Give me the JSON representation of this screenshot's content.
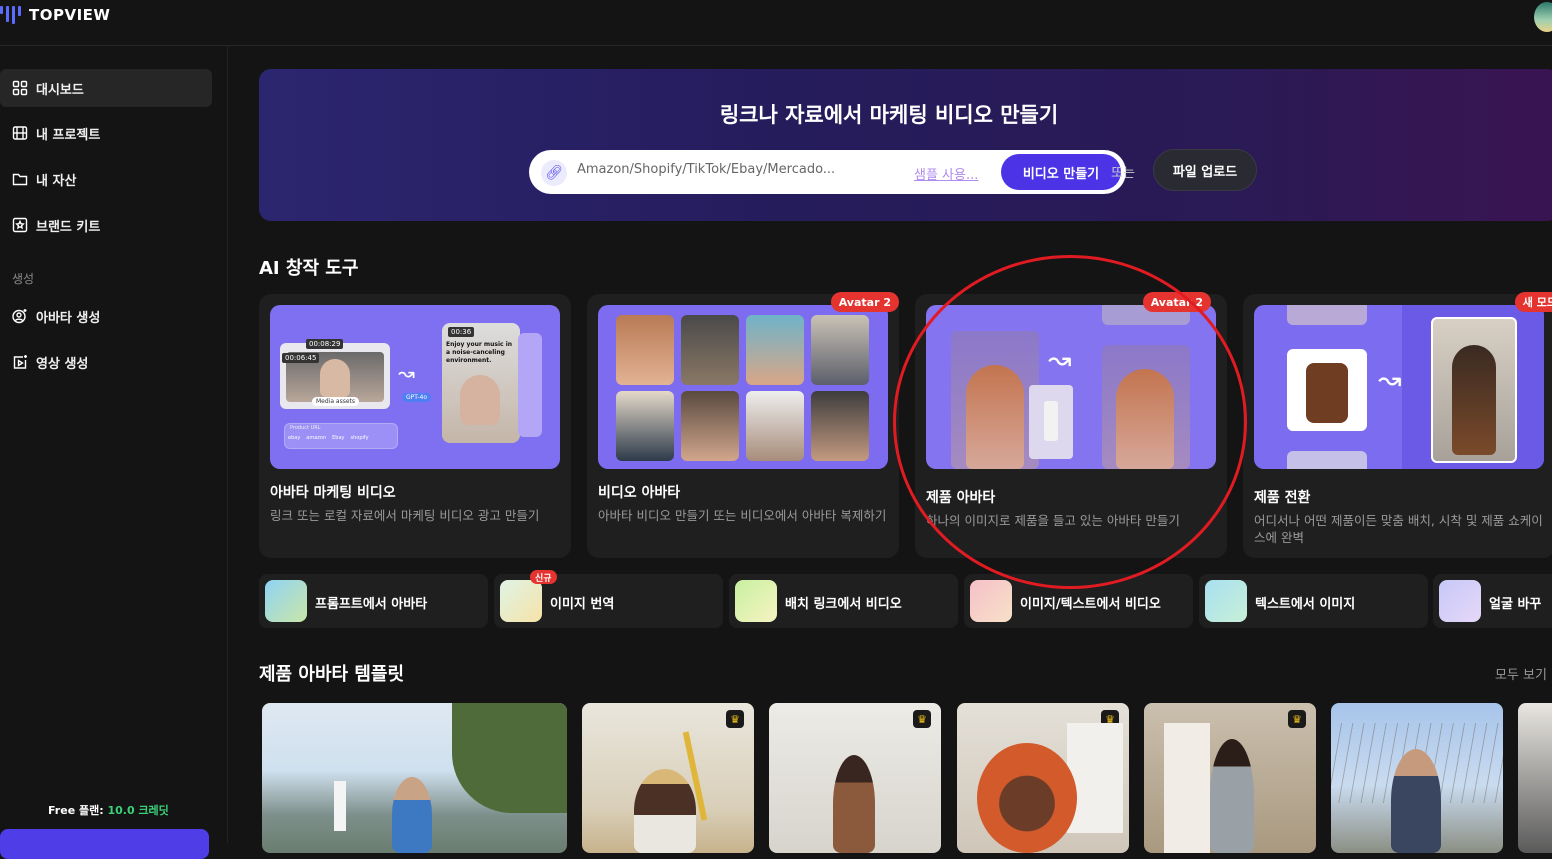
{
  "header": {
    "logo_text": "TOPVIEW"
  },
  "sidebar": {
    "items": [
      {
        "label": "대시보드",
        "icon": "grid-icon",
        "active": true
      },
      {
        "label": "내 프로젝트",
        "icon": "film-icon"
      },
      {
        "label": "내 자산",
        "icon": "folder-icon"
      },
      {
        "label": "브랜드 키트",
        "icon": "brand-star-icon"
      }
    ],
    "section_label": "생성",
    "create_items": [
      {
        "label": "아바타 생성",
        "icon": "avatar-sparkle-icon"
      },
      {
        "label": "영상 생성",
        "icon": "video-sparkle-icon"
      }
    ],
    "plan_prefix": "Free 플랜: ",
    "plan_credit": "10.0 크레딧"
  },
  "hero": {
    "title": "링크나 자료에서 마케팅 비디오 만들기",
    "input_placeholder": "Amazon/Shopify/TikTok/Ebay/Mercado...",
    "sample_link": "샘플 사용...",
    "make_button": "비디오 만들기",
    "or_text": "또는",
    "upload_button": "파일 업로드"
  },
  "ai_tools": {
    "title": "AI 창작 도구",
    "cards": [
      {
        "name": "아바타 마케팅 비디오",
        "desc": "링크 또는 로컬 자료에서 마케팅 비디오 광고 만들기",
        "badge": ""
      },
      {
        "name": "비디오 아바타",
        "desc": "아바타 비디오 만들기 또는 비디오에서 아바타 복제하기",
        "badge": "Avatar 2"
      },
      {
        "name": "제품 아바타",
        "desc": "하나의 이미지로 제품을 들고 있는 아바타 만들기",
        "badge": "Avatar 2"
      },
      {
        "name": "제품 전환",
        "desc": "어디서나 어떤 제품이든 맞춤 배치, 시착 및 제품 쇼케이스에 완벽",
        "badge": "새 모드"
      }
    ],
    "thumb_texts": {
      "time_a": "00:08:29",
      "time_b": "00:06:45",
      "time_c": "00:36",
      "caption": "Enjoy your music in a noise-canceling environment.",
      "media_chip": "Media assets",
      "gpt_chip": "GPT-4o",
      "product_url": "Product URL",
      "stores": [
        "ebay",
        "amazon",
        "Ebay",
        "shopify"
      ]
    }
  },
  "mini_tools": [
    {
      "label": "프롬프트에서 아바타",
      "new": ""
    },
    {
      "label": "이미지 번역",
      "new": "신규"
    },
    {
      "label": "배치 링크에서 비디오",
      "new": ""
    },
    {
      "label": "이미지/텍스트에서 비디오",
      "new": ""
    },
    {
      "label": "텍스트에서 이미지",
      "new": ""
    },
    {
      "label": "얼굴 바꾸",
      "new": ""
    }
  ],
  "templates": {
    "title": "제품 아바타 템플릿",
    "see_all": "모두 보기",
    "crown_icon": "crown-icon"
  },
  "colors": {
    "accent": "#4c34e6",
    "badge": "#e5332f",
    "credit": "#3ad17a",
    "annotation": "#e11b22"
  }
}
